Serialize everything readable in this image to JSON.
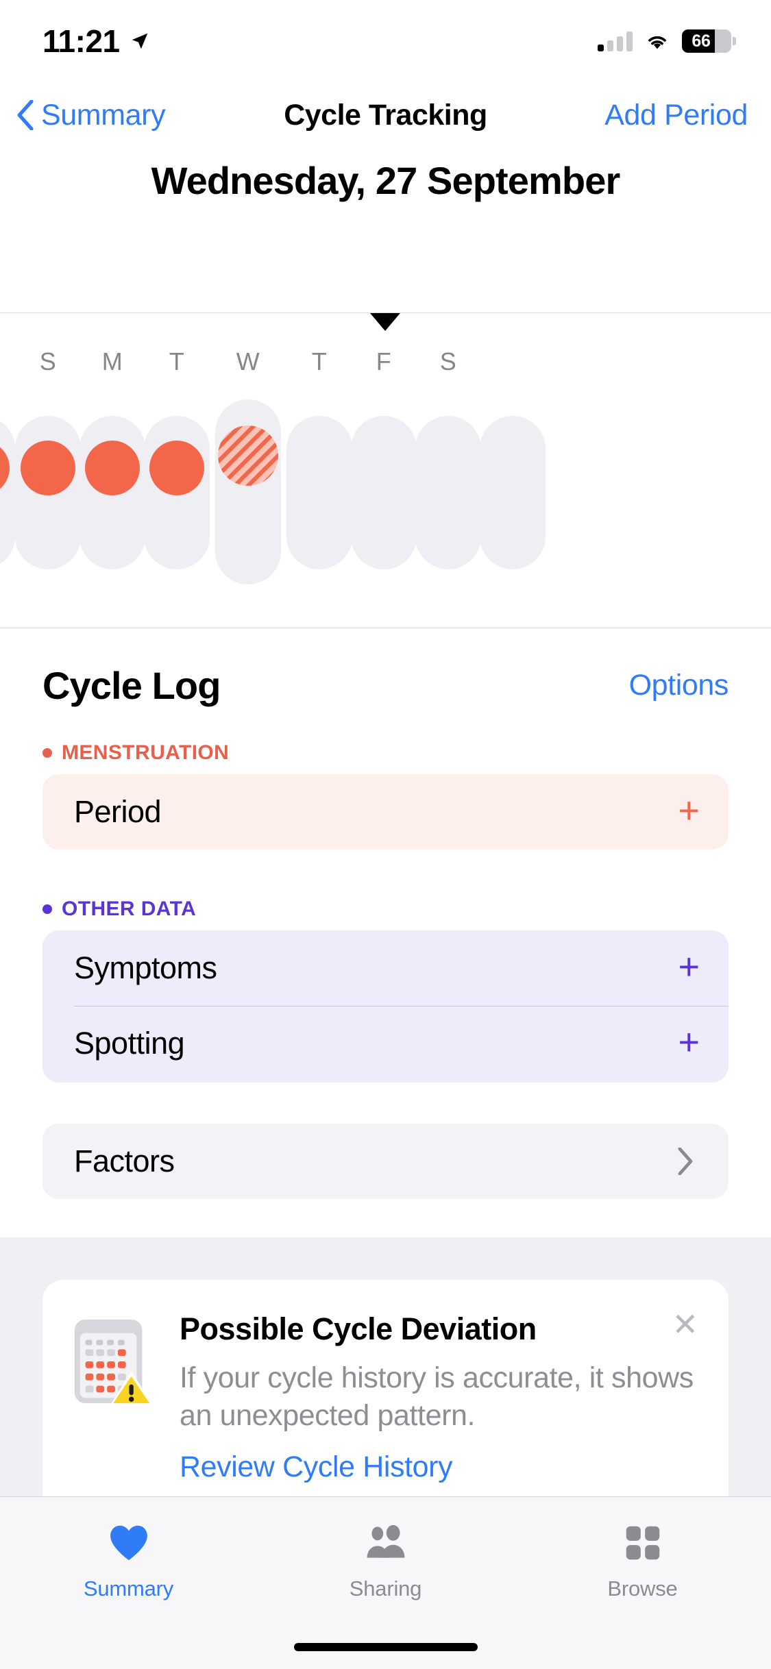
{
  "status_bar": {
    "time": "11:21",
    "location_icon": "location-arrow-icon",
    "cellular_icon": "cellular-bars-icon",
    "wifi_icon": "wifi-icon",
    "battery_percent": "66"
  },
  "nav": {
    "back_label": "Summary",
    "back_icon": "chevron-left-icon",
    "title": "Cycle Tracking",
    "action_label": "Add Period"
  },
  "date_header": {
    "text": "Wednesday, 27 September"
  },
  "week_strip": {
    "selected_marker_icon": "triangle-down-icon",
    "days": [
      {
        "letter": "S",
        "state": "period",
        "today": false
      },
      {
        "letter": "M",
        "state": "period",
        "today": false
      },
      {
        "letter": "T",
        "state": "period",
        "today": false
      },
      {
        "letter": "W",
        "state": "predicted",
        "today": true
      },
      {
        "letter": "T",
        "state": "empty",
        "today": false
      },
      {
        "letter": "F",
        "state": "empty",
        "today": false
      },
      {
        "letter": "S",
        "state": "empty",
        "today": false
      }
    ],
    "colors": {
      "period_dot": "#F4664A",
      "pill_background": "#EEEEF3",
      "predicted_stripe_light": "#FBC2B5"
    }
  },
  "cycle_log": {
    "title": "Cycle Log",
    "options_label": "Options",
    "menstruation": {
      "label": "MENSTRUATION",
      "color": "#E8604A",
      "rows": [
        {
          "label": "Period",
          "action_icon": "plus-icon"
        }
      ]
    },
    "other_data": {
      "label": "OTHER DATA",
      "color": "#5B34D6",
      "rows": [
        {
          "label": "Symptoms",
          "action_icon": "plus-icon"
        },
        {
          "label": "Spotting",
          "action_icon": "plus-icon"
        }
      ]
    },
    "factors": {
      "label": "Factors",
      "action_icon": "chevron-right-icon"
    }
  },
  "deviation_card": {
    "icon": "calendar-warning-icon",
    "title": "Possible Cycle Deviation",
    "body": "If your cycle history is accurate, it shows an unexpected pattern.",
    "link": "Review Cycle History",
    "close_icon": "close-icon"
  },
  "tab_bar": {
    "tabs": [
      {
        "label": "Summary",
        "icon": "heart-icon",
        "active": true
      },
      {
        "label": "Sharing",
        "icon": "people-icon",
        "active": false
      },
      {
        "label": "Browse",
        "icon": "grid-icon",
        "active": false
      }
    ],
    "active_color": "#2F7CF6"
  }
}
